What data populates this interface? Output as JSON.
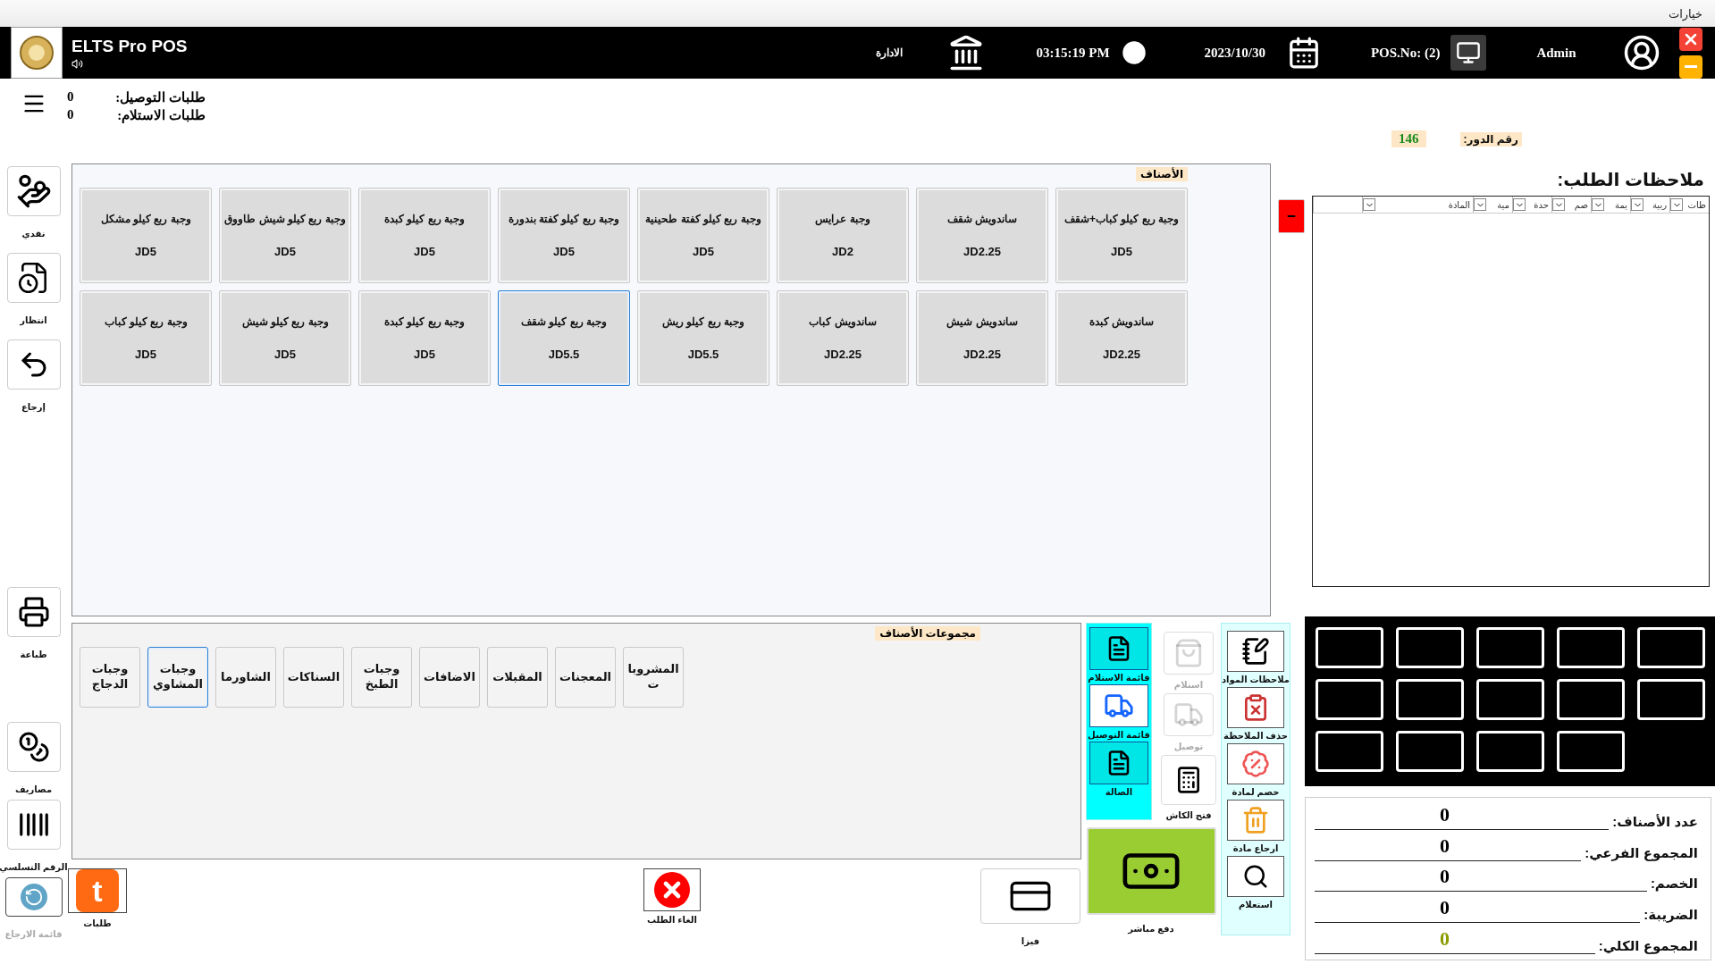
{
  "options_menu": "خيارات",
  "header": {
    "app_title": "ELTS Pro POS",
    "admin_link": "الادارة",
    "time": "03:15:19 PM",
    "date": "2023/10/30",
    "pos_number": "POS.No: (2)",
    "user": "Admin"
  },
  "order_counts": [
    {
      "label": "طلبات التوصيل:",
      "value": "0"
    },
    {
      "label": "طلبات الاستلام:",
      "value": "0"
    }
  ],
  "queue": {
    "label": "رقم الدور:",
    "value": "146"
  },
  "left_rail": [
    [
      {
        "kind": "cash",
        "label": "نقدي",
        "disabled": false
      },
      {
        "kind": "hold",
        "label": "انتظار",
        "disabled": false
      },
      {
        "kind": "return",
        "label": "إرجاع",
        "disabled": false
      }
    ],
    [
      {
        "kind": "print",
        "label": "طباعة",
        "disabled": false
      }
    ],
    [
      {
        "kind": "expenses",
        "label": "مصاريف",
        "disabled": false
      },
      {
        "kind": "serial",
        "label": "الرقم التسلسي",
        "disabled": false
      },
      {
        "kind": "return-list",
        "label": "قائمة الارجاع",
        "disabled": true
      }
    ]
  ],
  "items_panel": {
    "title": "الأصناف",
    "items": [
      {
        "name": "وجبة ربع كيلو كباب+شقف",
        "price": "JD5",
        "selected": false
      },
      {
        "name": "ساندويش شقف",
        "price": "JD2.25",
        "selected": false
      },
      {
        "name": "وجبة عرايس",
        "price": "JD2",
        "selected": false
      },
      {
        "name": "وجبة ربع كيلو كفتة طحينية",
        "price": "JD5",
        "selected": false
      },
      {
        "name": "وجبة ربع كيلو كفتة بندورة",
        "price": "JD5",
        "selected": false
      },
      {
        "name": "وجبة ربع كيلو كبدة",
        "price": "JD5",
        "selected": false
      },
      {
        "name": "وجبة ربع كيلو شيش طاووق",
        "price": "JD5",
        "selected": false
      },
      {
        "name": "وجبة ربع كيلو مشكل",
        "price": "JD5",
        "selected": false
      },
      {
        "name": "ساندويش كبدة",
        "price": "JD2.25",
        "selected": false
      },
      {
        "name": "ساندويش شيش",
        "price": "JD2.25",
        "selected": false
      },
      {
        "name": "ساندويش كباب",
        "price": "JD2.25",
        "selected": false
      },
      {
        "name": "وجبة ربع كيلو ريش",
        "price": "JD5.5",
        "selected": false
      },
      {
        "name": "وجبة ربع كيلو شقف",
        "price": "JD5.5",
        "selected": true
      },
      {
        "name": "وجبة ربع كيلو كبدة",
        "price": "JD5",
        "selected": false
      },
      {
        "name": "وجبة ربع كيلو شيش",
        "price": "JD5",
        "selected": false
      },
      {
        "name": "وجبة ربع كيلو كباب",
        "price": "JD5",
        "selected": false
      }
    ]
  },
  "groups_panel": {
    "title": "مجموعات الأصناف",
    "groups": [
      {
        "label": "المشروبات",
        "selected": false
      },
      {
        "label": "المعجنات",
        "selected": false
      },
      {
        "label": "المقبلات",
        "selected": false
      },
      {
        "label": "الاضافات",
        "selected": false
      },
      {
        "label": "وجبات الطبخ",
        "selected": false
      },
      {
        "label": "السناكات",
        "selected": false
      },
      {
        "label": "الشاورما",
        "selected": false
      },
      {
        "label": "وجبات المشاوي",
        "selected": true
      },
      {
        "label": "وجبات الدجاج",
        "selected": false
      }
    ]
  },
  "bottom_buttons": [
    {
      "kind": "visa",
      "label": "فيزا"
    },
    {
      "kind": "cancel",
      "label": "الغاء الطلب"
    },
    {
      "kind": "orders",
      "label": "طلبات",
      "logo_text": "t"
    }
  ],
  "order_modes": [
    {
      "kind": "pickup-list",
      "label": "قائمة الاستلام"
    },
    {
      "kind": "delivery-list",
      "label": "قائمة التوصيل"
    },
    {
      "kind": "hall",
      "label": "الصالة"
    }
  ],
  "service_actions": [
    {
      "kind": "pickup",
      "label": "استلام",
      "disabled": true
    },
    {
      "kind": "delivery",
      "label": "توصيل",
      "disabled": true
    },
    {
      "kind": "cash-drawer",
      "label": "فتح الكاش",
      "disabled": false
    }
  ],
  "direct_payment": {
    "label": "دفع مباشر"
  },
  "item_tools": [
    {
      "kind": "item-notes",
      "label": "ملاحظات المواد"
    },
    {
      "kind": "delete-note",
      "label": "حذف الملاحظة"
    },
    {
      "kind": "item-discount",
      "label": "خصم لمادة"
    },
    {
      "kind": "return-item",
      "label": "ارجاع مادة"
    },
    {
      "kind": "inquiry",
      "label": "استعلام"
    }
  ],
  "notes": {
    "title": "ملاحظات الطلب:",
    "columns": [
      "ظات",
      "ربية",
      "يمة",
      "صم",
      "حدة",
      "مية",
      "المادة"
    ]
  },
  "totals": [
    {
      "label": "عدد الأصناف:",
      "value": "0",
      "highlight": false
    },
    {
      "label": "المجموع الفرعي:",
      "value": "0",
      "highlight": false
    },
    {
      "label": "الخصم:",
      "value": "0",
      "highlight": false
    },
    {
      "label": "الضريبة:",
      "value": "0",
      "highlight": false
    },
    {
      "label": "المجموع الكلي:",
      "value": "0",
      "highlight": true
    }
  ]
}
